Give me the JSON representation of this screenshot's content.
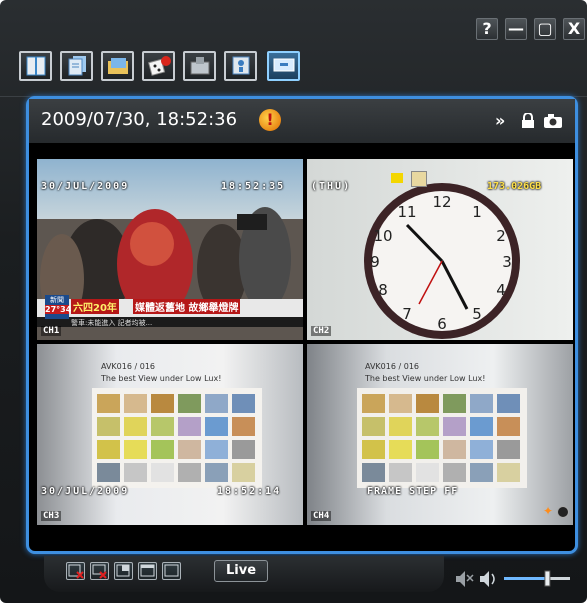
{
  "window": {
    "help_label": "?",
    "minimize_label": "—",
    "maximize_label": "▢",
    "close_label": "X"
  },
  "toolbar": {
    "buttons": [
      "info",
      "records",
      "schedule",
      "network",
      "backup",
      "playback",
      "live-view"
    ],
    "active": "live-view"
  },
  "header": {
    "datetime": "2009/07/30, 18:52:36",
    "alert_symbol": "!",
    "icons": [
      "double-chevron-icon",
      "lock-icon",
      "camera-icon"
    ]
  },
  "channels": [
    {
      "label": "CH1",
      "osd_date": "30/JUL/2009",
      "osd_time": "18:52:35",
      "news_tag": "六四20年",
      "news_headline": "媒體返舊地 故鄉舉燈牌",
      "news_sub": "警車:未能進入 記者均被...",
      "news_corner": "27°34",
      "news_corner_label": "新聞"
    },
    {
      "label": "CH2",
      "osd_day": "(THU)",
      "hdd": "173.026GB"
    },
    {
      "label": "CH3",
      "chart_text1": "AVK016 / 016",
      "chart_text2": "The best View under Low Lux!",
      "osd_date": "30/JUL/2009",
      "osd_time": "18:52:14"
    },
    {
      "label": "CH4",
      "chart_text1": "AVK016 / 016",
      "chart_text2": "The best View under Low Lux!",
      "osd_mode": "FRAME STEP FF"
    }
  ],
  "bottom": {
    "live_label": "Live"
  },
  "volume_level": 0.65,
  "colors": {
    "accent_blue": "#3e8fe0",
    "background": "#1b1e20"
  }
}
